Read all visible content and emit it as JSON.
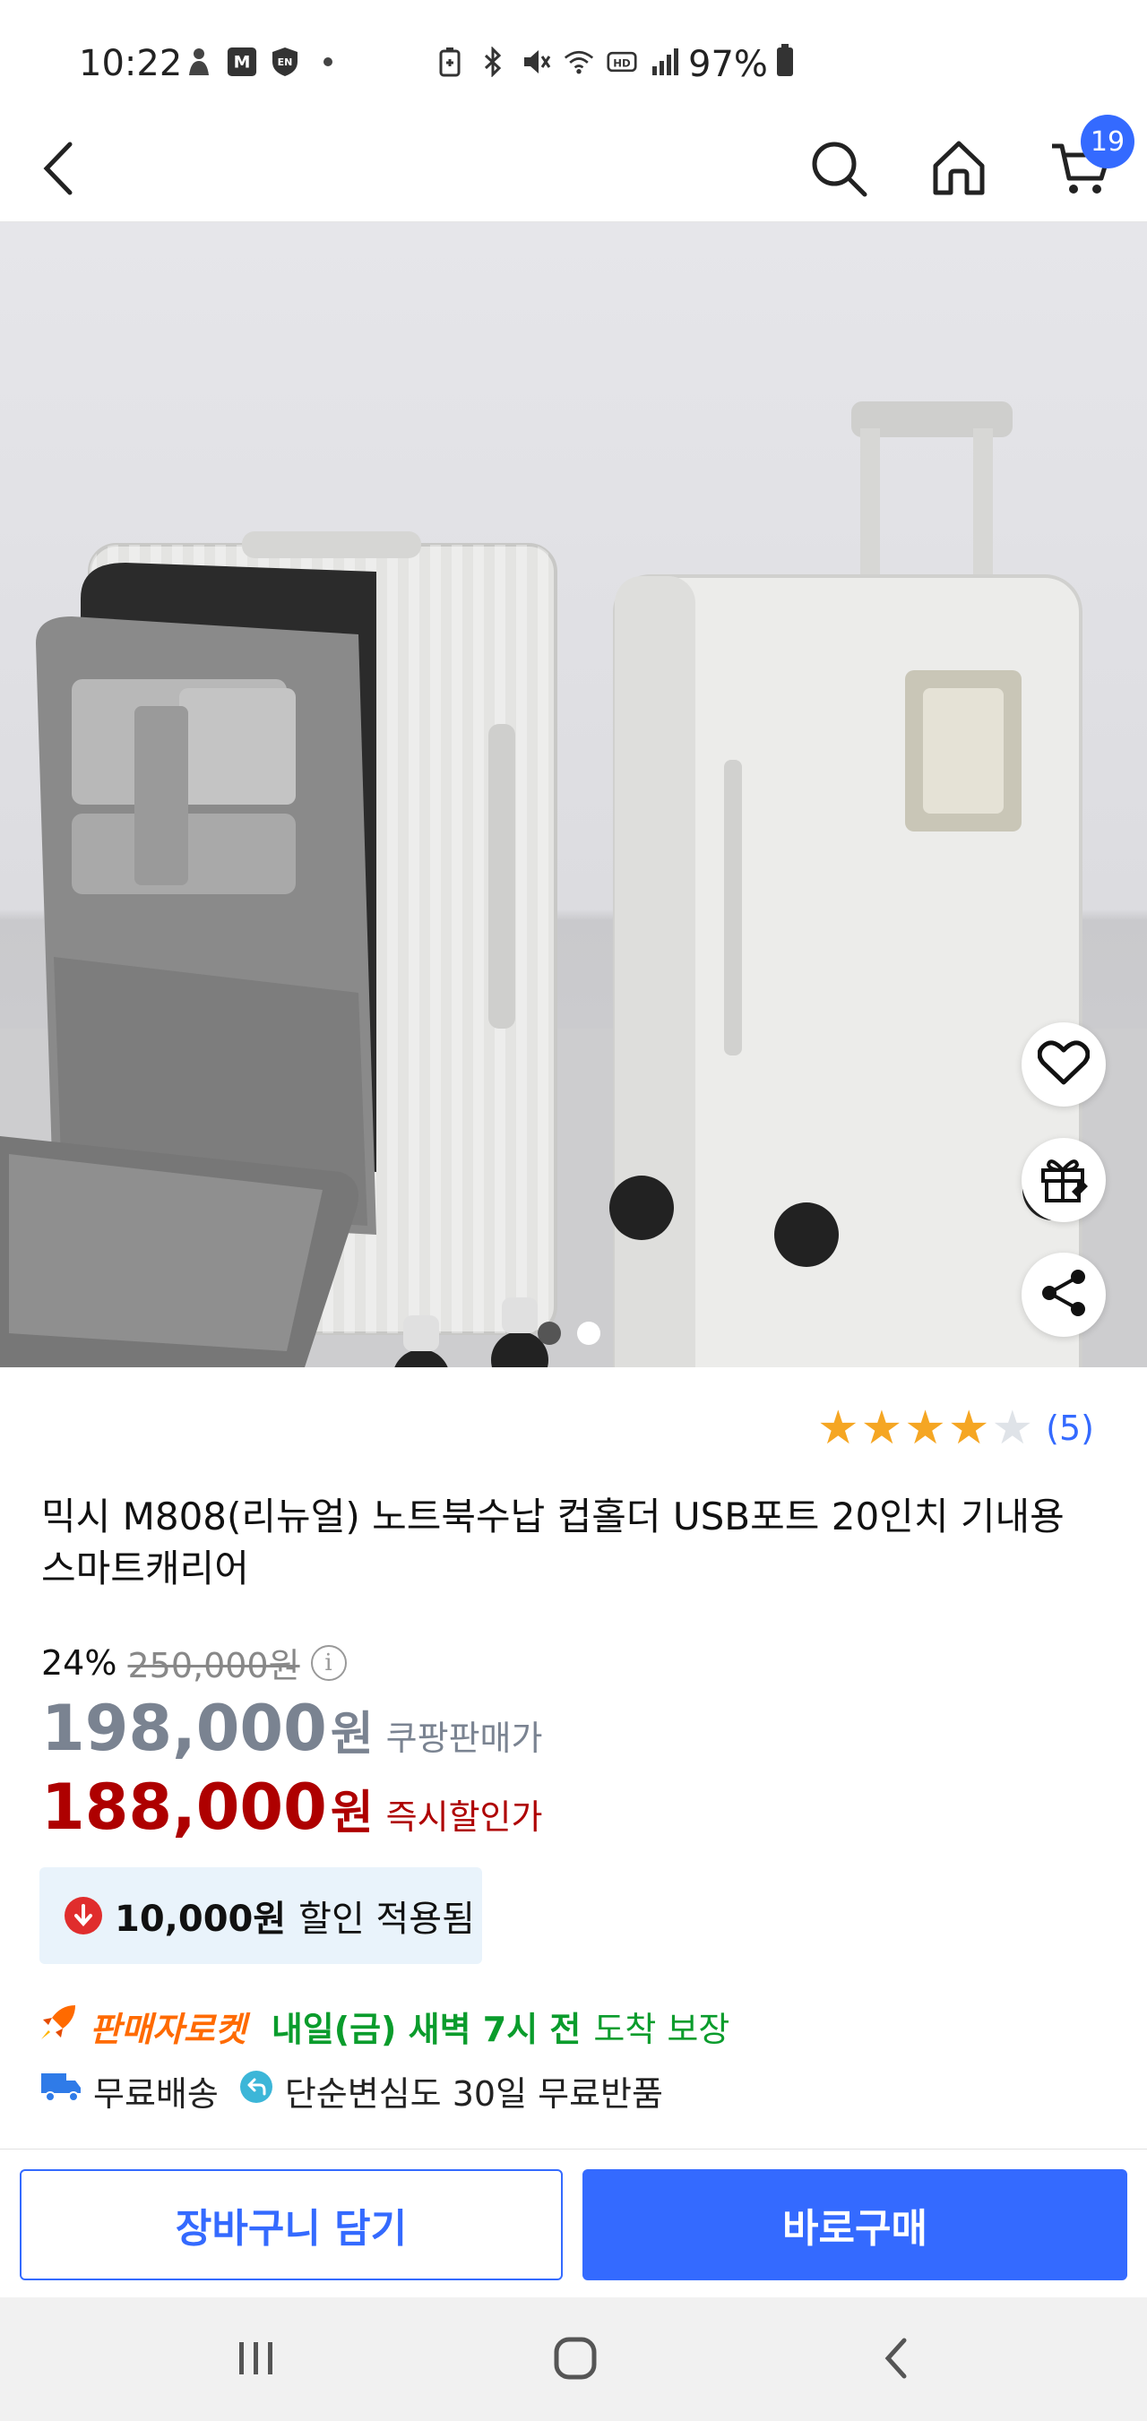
{
  "status_bar": {
    "time": "10:22",
    "battery": "97%",
    "left_icons": [
      "person-icon",
      "m-stock-app-icon",
      "en-shield-icon",
      "dot-icon"
    ],
    "right_icons": [
      "battery-saver-icon",
      "bluetooth-icon",
      "mute-icon",
      "wifi-icon",
      "hd-icon",
      "signal-icon"
    ]
  },
  "header": {
    "back_icon": "chevron-left-icon",
    "search_icon": "search-icon",
    "home_icon": "home-icon",
    "cart_icon": "cart-icon",
    "cart_count": "19"
  },
  "gallery": {
    "image_alt": "White carry-on suitcase with front laptop pocket",
    "current_index": 1,
    "total_images": 2,
    "actions": [
      "heart-icon",
      "gift-icon",
      "share-icon"
    ]
  },
  "product": {
    "rating_stars": 4,
    "rating_count": "(5)",
    "title": "믹시 M808(리뉴얼) 노트북수납 컵홀더 USB포트 20인치 기내용 스마트캐리어",
    "discount_rate": "24%",
    "original_price": "250,000원",
    "coupang_price": "198,000",
    "coupang_price_unit": "원",
    "coupang_price_label": "쿠팡판매가",
    "instant_price": "188,000",
    "instant_price_unit": "원",
    "instant_price_label": "즉시할인가",
    "coupon_amount": "10,000원",
    "coupon_text": "할인 적용됨",
    "rocket_label": "판매자로켓",
    "delivery_time": "내일(금) 새벽 7시 전",
    "delivery_guarantee": "도착 보장",
    "free_shipping": "무료배송",
    "free_return": "단순변심도 30일 무료반품"
  },
  "actions": {
    "add_to_cart": "장바구니 담기",
    "buy_now": "바로구매"
  },
  "colors": {
    "accent": "#346aff",
    "price_red": "#ae0000",
    "star": "#f5a623",
    "green": "#0a9c2c",
    "rocket_orange": "#ff6a00"
  }
}
